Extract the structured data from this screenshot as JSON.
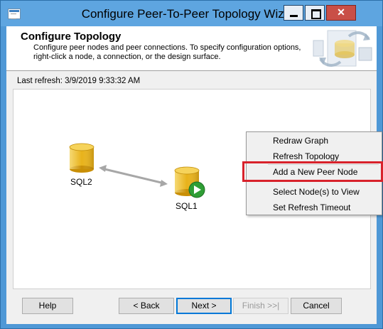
{
  "window": {
    "title": "Configure Peer-To-Peer Topology Wizard",
    "close_glyph": "✕"
  },
  "header": {
    "title": "Configure Topology",
    "subtitle": "Configure peer nodes and peer connections. To specify configuration options, right-click a node, a connection, or the design surface."
  },
  "status": {
    "last_refresh": "Last refresh: 3/9/2019 9:33:32 AM"
  },
  "nodes": [
    {
      "label": "SQL2"
    },
    {
      "label": "SQL1"
    }
  ],
  "context_menu": {
    "items": [
      {
        "label": "Redraw Graph"
      },
      {
        "label": "Refresh Topology"
      },
      {
        "label": "Add a New Peer Node"
      },
      {
        "label": "Select Node(s) to View"
      },
      {
        "label": "Set Refresh Timeout"
      }
    ],
    "highlighted_item": "Add a New Peer Node"
  },
  "buttons": {
    "help": "Help",
    "back": "< Back",
    "next": "Next >",
    "finish": "Finish >>|",
    "cancel": "Cancel"
  },
  "colors": {
    "titlebar": "#5ea5e0",
    "highlight": "#d8222b",
    "node_body": "#e8b21a",
    "play_badge": "#2f9e35"
  },
  "icons": [
    "app-icon",
    "wizard-header-icon",
    "database-icon",
    "play-icon",
    "minimize-icon",
    "maximize-icon",
    "close-icon"
  ]
}
